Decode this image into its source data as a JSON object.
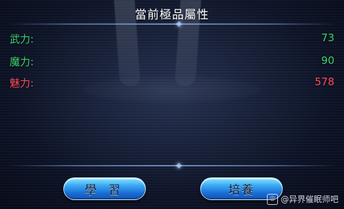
{
  "panel": {
    "title": "當前極品屬性"
  },
  "stats": [
    {
      "label": "武力:",
      "value": "73",
      "color": "#3fd26b"
    },
    {
      "label": "魔力:",
      "value": "90",
      "color": "#3fd26b"
    },
    {
      "label": "魅力:",
      "value": "578",
      "color": "#ff4b5a"
    }
  ],
  "buttons": {
    "learn_label": "學 習",
    "train_label": "培養"
  },
  "watermark": {
    "text": "@异界催眠师吧",
    "icon": "baidu-tieba-icon"
  }
}
